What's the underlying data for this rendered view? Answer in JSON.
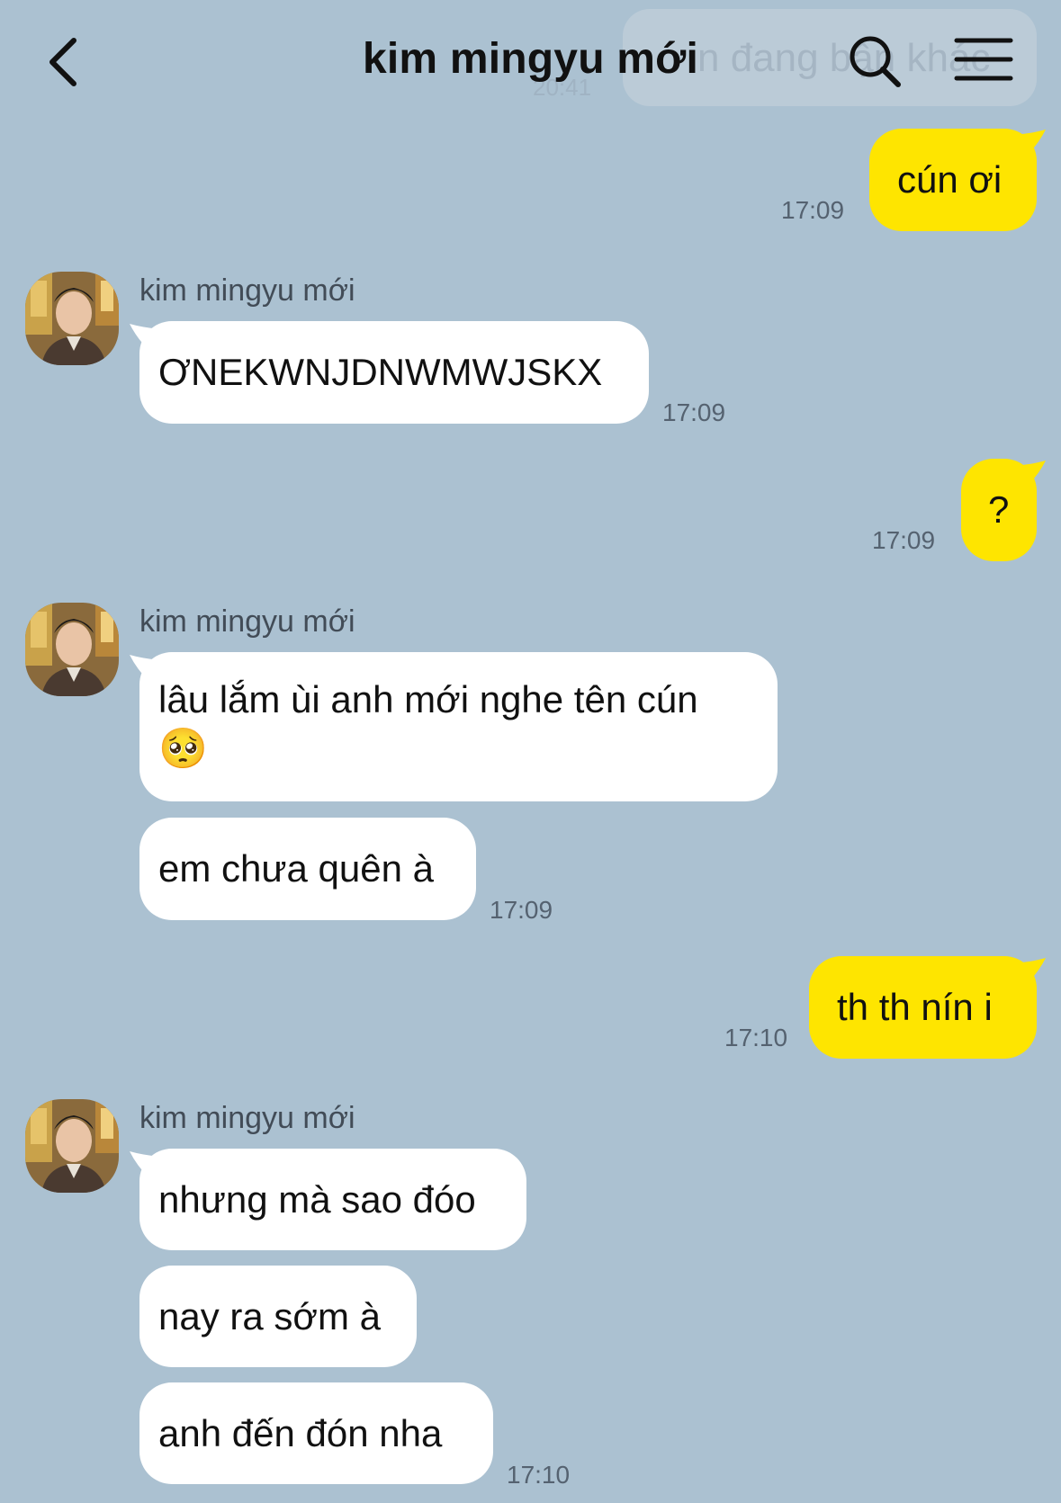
{
  "header": {
    "title": "kim mingyu mới",
    "back_icon": "chevron-left-icon",
    "search_icon": "search-icon",
    "menu_icon": "hamburger-menu-icon",
    "ghost_text": "n đang bận khác",
    "ghost_time": "20:41"
  },
  "colors": {
    "background": "#abc1d1",
    "outgoing_bubble": "#fee500",
    "incoming_bubble": "#ffffff"
  },
  "messages": [
    {
      "id": "m1",
      "direction": "out",
      "text": "cún ơi",
      "time": "17:09"
    },
    {
      "id": "m2",
      "direction": "in",
      "sender": "kim mingyu mới",
      "text": "ƠNEKWNJDNWMWJSKX",
      "time": "17:09"
    },
    {
      "id": "m3",
      "direction": "out",
      "text": "?",
      "time": "17:09"
    },
    {
      "id": "m4",
      "direction": "in",
      "sender": "kim mingyu mới",
      "text_line1": "lâu lắm ùi anh mới nghe tên cún",
      "text_line2": "🥺",
      "text2": "em chưa quên à",
      "time": "17:09"
    },
    {
      "id": "m5",
      "direction": "out",
      "text": "th th nín i",
      "time": "17:10"
    },
    {
      "id": "m6",
      "direction": "in",
      "sender": "kim mingyu mới",
      "text1": "nhưng mà sao đóo",
      "text2": "nay ra sớm à",
      "text3": "anh đến đón nha",
      "time": "17:10"
    }
  ]
}
